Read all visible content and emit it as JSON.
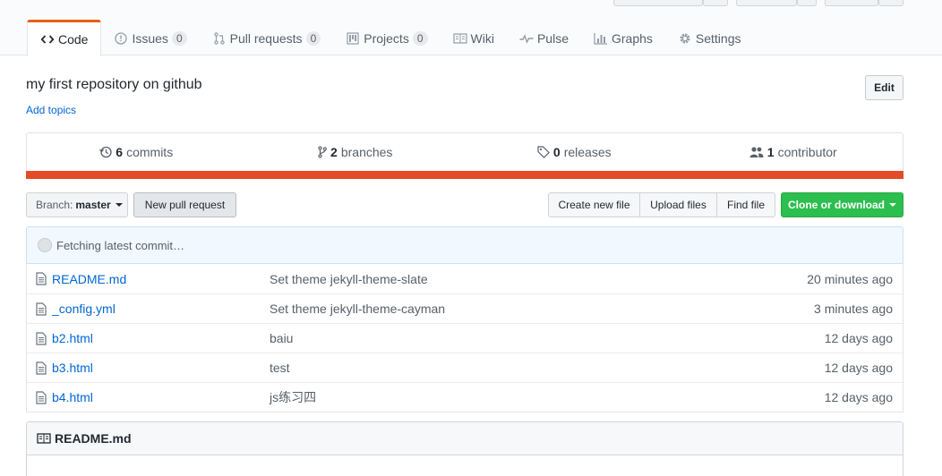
{
  "tabs": [
    {
      "label": "Code",
      "icon": "code-icon",
      "selected": true
    },
    {
      "label": "Issues",
      "icon": "issue-opened-icon",
      "count": "0"
    },
    {
      "label": "Pull requests",
      "icon": "git-pull-request-icon",
      "count": "0"
    },
    {
      "label": "Projects",
      "icon": "project-icon",
      "count": "0"
    },
    {
      "label": "Wiki",
      "icon": "book-icon"
    },
    {
      "label": "Pulse",
      "icon": "pulse-icon"
    },
    {
      "label": "Graphs",
      "icon": "graph-icon"
    },
    {
      "label": "Settings",
      "icon": "gear-icon"
    }
  ],
  "repo": {
    "description": "my first repository on github",
    "add_topics": "Add topics",
    "edit_label": "Edit"
  },
  "summary": {
    "commits_count": "6",
    "commits_label": "commits",
    "branches_count": "2",
    "branches_label": "branches",
    "releases_count": "0",
    "releases_label": "releases",
    "contributors_count": "1",
    "contributors_label": "contributor",
    "language_color": "#e34c26"
  },
  "toolbar": {
    "branch_prefix": "Branch:",
    "branch_name": "master",
    "new_pr": "New pull request",
    "create_file": "Create new file",
    "upload_files": "Upload files",
    "find_file": "Find file",
    "clone": "Clone or download"
  },
  "commit_bar": {
    "text": "Fetching latest commit…"
  },
  "files": [
    {
      "name": "README.md",
      "message": "Set theme jekyll-theme-slate",
      "age": "20 minutes ago"
    },
    {
      "name": "_config.yml",
      "message": "Set theme jekyll-theme-cayman",
      "age": "3 minutes ago"
    },
    {
      "name": "b2.html",
      "message": "baiu",
      "age": "12 days ago"
    },
    {
      "name": "b3.html",
      "message": "test",
      "age": "12 days ago"
    },
    {
      "name": "b4.html",
      "message": "js练习四",
      "age": "12 days ago"
    }
  ],
  "readme": {
    "title": "README.md"
  },
  "colors": {
    "accent_tab": "#e36209",
    "link": "#0366d6",
    "clone_green": "#2cbe4e"
  }
}
